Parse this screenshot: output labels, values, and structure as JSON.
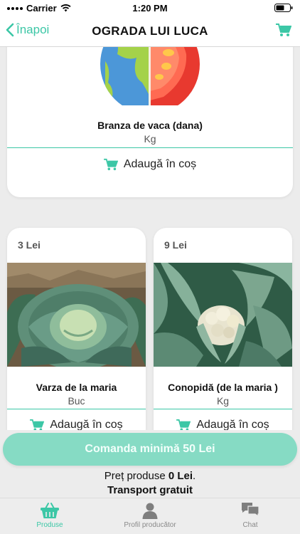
{
  "status_bar": {
    "carrier": "Carrier",
    "time": "1:20 PM"
  },
  "nav": {
    "back_label": "Înapoi",
    "title": "OGRADA LUI LUCA",
    "cart_icon": "cart-icon"
  },
  "products": [
    {
      "name": "Branza de vaca (dana)",
      "unit": "Kg",
      "add_label": "Adaugă în coș",
      "image": "earth-tomato-illustration"
    },
    {
      "price": "3 Lei",
      "name": "Varza de la maria",
      "unit": "Buc",
      "add_label": "Adaugă în coș",
      "image": "cabbage-photo"
    },
    {
      "price": "9 Lei",
      "name": "Conopidă (de la maria )",
      "unit": "Kg",
      "add_label": "Adaugă în coș",
      "image": "cauliflower-photo"
    }
  ],
  "order": {
    "button_label": "Comanda minimă 50 Lei",
    "price_prefix": "Preț produse ",
    "price_value": "0 Lei",
    "price_suffix": ".",
    "transport": "Transport gratuit"
  },
  "tabs": [
    {
      "label": "Produse",
      "icon": "basket-icon",
      "active": true
    },
    {
      "label": "Profil producător",
      "icon": "person-icon",
      "active": false
    },
    {
      "label": "Chat",
      "icon": "chat-icon",
      "active": false
    }
  ],
  "colors": {
    "accent": "#3cc7a6",
    "order_button": "#86dbc4",
    "background": "#ececec"
  }
}
